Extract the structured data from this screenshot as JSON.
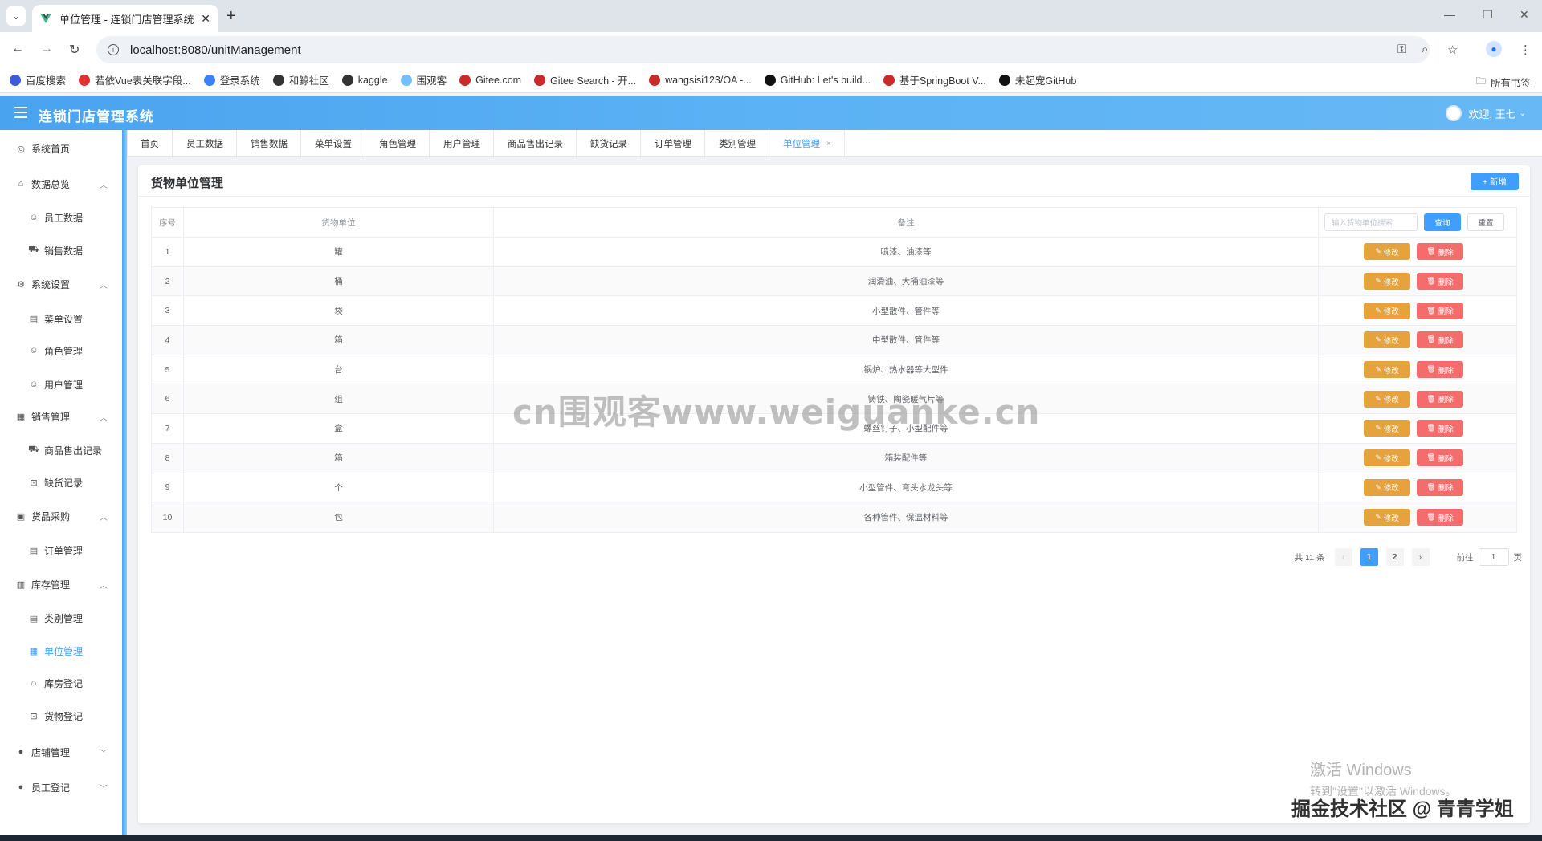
{
  "browser": {
    "tab_title": "单位管理 - 连锁门店管理系统",
    "tab_close": "✕",
    "new_tab": "+",
    "url": "localhost:8080/unitManagement",
    "bookmarks": [
      {
        "label": "百度搜索",
        "color": "#3b5bdb"
      },
      {
        "label": "若依Vue表关联字段...",
        "color": "#e03131"
      },
      {
        "label": "登录系统",
        "color": "#3b82f6"
      },
      {
        "label": "和鲸社区",
        "color": "#333333"
      },
      {
        "label": "kaggle",
        "color": "#333333"
      },
      {
        "label": "围观客",
        "color": "#74c0fc"
      },
      {
        "label": "Gitee.com",
        "color": "#c92a2a"
      },
      {
        "label": "Gitee Search - 开...",
        "color": "#c92a2a"
      },
      {
        "label": "wangsisi123/OA -...",
        "color": "#c92a2a"
      },
      {
        "label": "GitHub: Let's build...",
        "color": "#111111"
      },
      {
        "label": "基于SpringBoot V...",
        "color": "#c92a2a"
      },
      {
        "label": "未起宠GitHub",
        "color": "#111111"
      }
    ],
    "all_bookmarks": "所有书签"
  },
  "app": {
    "title": "连锁门店管理系统",
    "welcome": "欢迎, 王七"
  },
  "sidebar": {
    "items": [
      {
        "label": "系统首页",
        "icon": "dashboard-icon",
        "level": "top"
      },
      {
        "label": "数据总览",
        "icon": "home-icon",
        "level": "top",
        "expanded": true
      },
      {
        "label": "员工数据",
        "icon": "user-icon",
        "level": "sub"
      },
      {
        "label": "销售数据",
        "icon": "truck-icon",
        "level": "sub"
      },
      {
        "label": "系统设置",
        "icon": "gear-icon",
        "level": "top",
        "expanded": true
      },
      {
        "label": "菜单设置",
        "icon": "document-icon",
        "level": "sub"
      },
      {
        "label": "角色管理",
        "icon": "user-icon",
        "level": "sub"
      },
      {
        "label": "用户管理",
        "icon": "user-icon",
        "level": "sub"
      },
      {
        "label": "销售管理",
        "icon": "grid-icon",
        "level": "top",
        "expanded": true
      },
      {
        "label": "商品售出记录",
        "icon": "truck-icon",
        "level": "sub"
      },
      {
        "label": "缺货记录",
        "icon": "bag-icon",
        "level": "sub"
      },
      {
        "label": "货品采购",
        "icon": "lock-icon",
        "level": "top",
        "expanded": true
      },
      {
        "label": "订单管理",
        "icon": "document-icon",
        "level": "sub"
      },
      {
        "label": "库存管理",
        "icon": "box-icon",
        "level": "top",
        "expanded": true
      },
      {
        "label": "类别管理",
        "icon": "document-icon",
        "level": "sub"
      },
      {
        "label": "单位管理",
        "icon": "office-icon",
        "level": "sub",
        "active": true
      },
      {
        "label": "库房登记",
        "icon": "house-icon",
        "level": "sub"
      },
      {
        "label": "货物登记",
        "icon": "bag-icon",
        "level": "sub"
      },
      {
        "label": "店铺管理",
        "icon": "person-icon",
        "level": "top",
        "expanded": false
      },
      {
        "label": "员工登记",
        "icon": "person-icon",
        "level": "top",
        "expanded": false
      }
    ]
  },
  "tags": [
    "首页",
    "员工数据",
    "销售数据",
    "菜单设置",
    "角色管理",
    "用户管理",
    "商品售出记录",
    "缺货记录",
    "订单管理",
    "类别管理",
    "单位管理"
  ],
  "tags_close": "×",
  "page": {
    "title": "货物单位管理",
    "add_button": "+ 新增",
    "columns": {
      "index": "序号",
      "unit": "货物单位",
      "remark": "备注"
    },
    "search_placeholder": "输入货物单位搜索",
    "search_button": "查询",
    "reset_button": "重置",
    "edit_label": "修改",
    "delete_label": "删除",
    "rows": [
      {
        "index": "1",
        "unit": "罐",
        "remark": "喷漆、油漆等"
      },
      {
        "index": "2",
        "unit": "桶",
        "remark": "润滑油、大桶油漆等"
      },
      {
        "index": "3",
        "unit": "袋",
        "remark": "小型散件、管件等"
      },
      {
        "index": "4",
        "unit": "箱",
        "remark": "中型散件、管件等"
      },
      {
        "index": "5",
        "unit": "台",
        "remark": "锅炉、热水器等大型件"
      },
      {
        "index": "6",
        "unit": "组",
        "remark": "铸铁、陶瓷暖气片等"
      },
      {
        "index": "7",
        "unit": "盒",
        "remark": "螺丝钉子、小型配件等"
      },
      {
        "index": "8",
        "unit": "箱",
        "remark": "箱装配件等"
      },
      {
        "index": "9",
        "unit": "个",
        "remark": "小型管件、弯头水龙头等"
      },
      {
        "index": "10",
        "unit": "包",
        "remark": "各种管件、保温材料等"
      }
    ],
    "pagination": {
      "total": "共 11 条",
      "pages": [
        "1",
        "2"
      ],
      "current": "1",
      "goto_label": "前往",
      "goto_value": "1",
      "page_suffix": "页"
    }
  },
  "overlay": {
    "watermark": "cn围观客www.weiguanke.cn",
    "windows_line1": "激活 Windows",
    "windows_line2": "转到\"设置\"以激活 Windows。",
    "juejin": "掘金技术社区 @ 青青学姐"
  }
}
